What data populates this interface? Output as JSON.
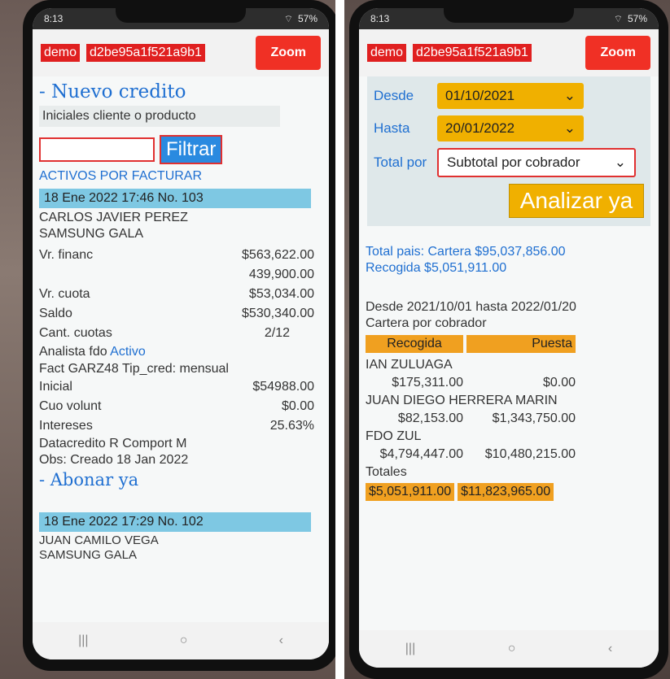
{
  "status_time": "8:13",
  "status_battery": "57%",
  "left": {
    "tag_demo": "demo",
    "tag_id": "d2be95a1f521a9b1",
    "zoom": "Zoom",
    "title": "- Nuevo credito",
    "search_label": "Iniciales cliente o producto",
    "search_value": "",
    "filter_btn": "Filtrar",
    "section": "ACTIVOS POR FACTURAR",
    "credit1": {
      "header": "18 Ene 2022 17:46   No. 103",
      "name": "CARLOS JAVIER PEREZ",
      "product": "SAMSUNG GALA",
      "financ_label": "Vr. financ",
      "financ_value": "$563,622.00",
      "financ_value2": "439,900.00",
      "cuota_label": "Vr. cuota",
      "cuota_value": "$53,034.00",
      "saldo_label": "Saldo",
      "saldo_value": "$530,340.00",
      "cuotas_label": "Cant. cuotas",
      "cuotas_value": "2/12",
      "analista_label": "Analista fdo",
      "analista_status": "Activo",
      "fact": "Fact GARZ48 Tip_cred: mensual",
      "inicial_label": "Inicial",
      "inicial_value": "$54988.00",
      "cuo_label": "Cuo volunt",
      "cuo_value": "$0.00",
      "int_label": "Intereses",
      "int_value": "25.63%",
      "datacredito": "Datacredito R Comport M",
      "obs": "Obs: Creado 18 Jan 2022",
      "abonar": "- Abonar ya"
    },
    "credit2": {
      "header": "18 Ene 2022 17:29   No. 102",
      "name": "JUAN CAMILO VEGA",
      "product": "SAMSUNG GALA"
    }
  },
  "right": {
    "tag_demo": "demo",
    "tag_id": "d2be95a1f521a9b1",
    "zoom": "Zoom",
    "desde_label": "Desde",
    "desde_value": "01/10/2021",
    "hasta_label": "Hasta",
    "hasta_value": "20/01/2022",
    "total_label": "Total por",
    "total_value": "Subtotal por cobrador",
    "analizar": "Analizar ya",
    "total_pais": "Total pais: Cartera $95,037,856.00",
    "recogida_total": "Recogida $5,051,911.00",
    "range": "Desde 2021/10/01 hasta 2022/01/20",
    "cartera": "Cartera por cobrador",
    "col_recogida": "Recogida",
    "col_puesta": "Puesta",
    "collectors": [
      {
        "name": "IAN ZULUAGA",
        "recogida": "$175,311.00",
        "puesta": "$0.00"
      },
      {
        "name": "JUAN DIEGO HERRERA MARIN",
        "recogida": "$82,153.00",
        "puesta": "$1,343,750.00"
      },
      {
        "name": "FDO ZUL",
        "recogida": "$4,794,447.00",
        "puesta": "$10,480,215.00"
      }
    ],
    "totales_label": "Totales",
    "total_recogida": "$5,051,911.00",
    "total_puesta": "$11,823,965.00"
  }
}
